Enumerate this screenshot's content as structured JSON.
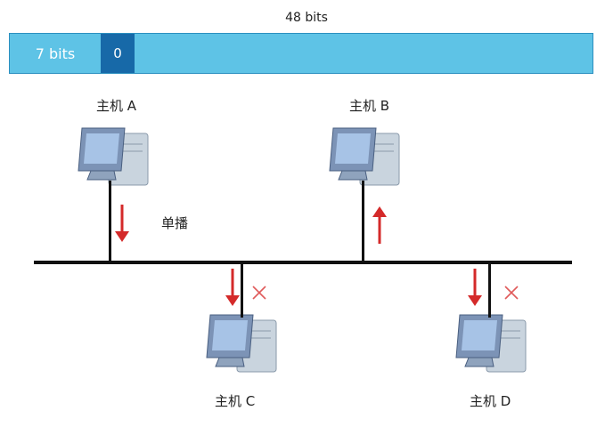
{
  "frame": {
    "title": "48 bits",
    "first_segment": "7 bits",
    "bit_value": "0"
  },
  "hosts": {
    "a": "主机 A",
    "b": "主机 B",
    "c": "主机 C",
    "d": "主机 D"
  },
  "unicast_label": "单播",
  "colors": {
    "frame_fill": "#5ec3e6",
    "bit_fill": "#1769a8",
    "arrow": "#d42a2a",
    "reject_mark": "#e05a5a"
  },
  "icons": {
    "computer": "computer-icon",
    "arrow": "red-arrow-icon",
    "reject": "x-mark-icon"
  }
}
